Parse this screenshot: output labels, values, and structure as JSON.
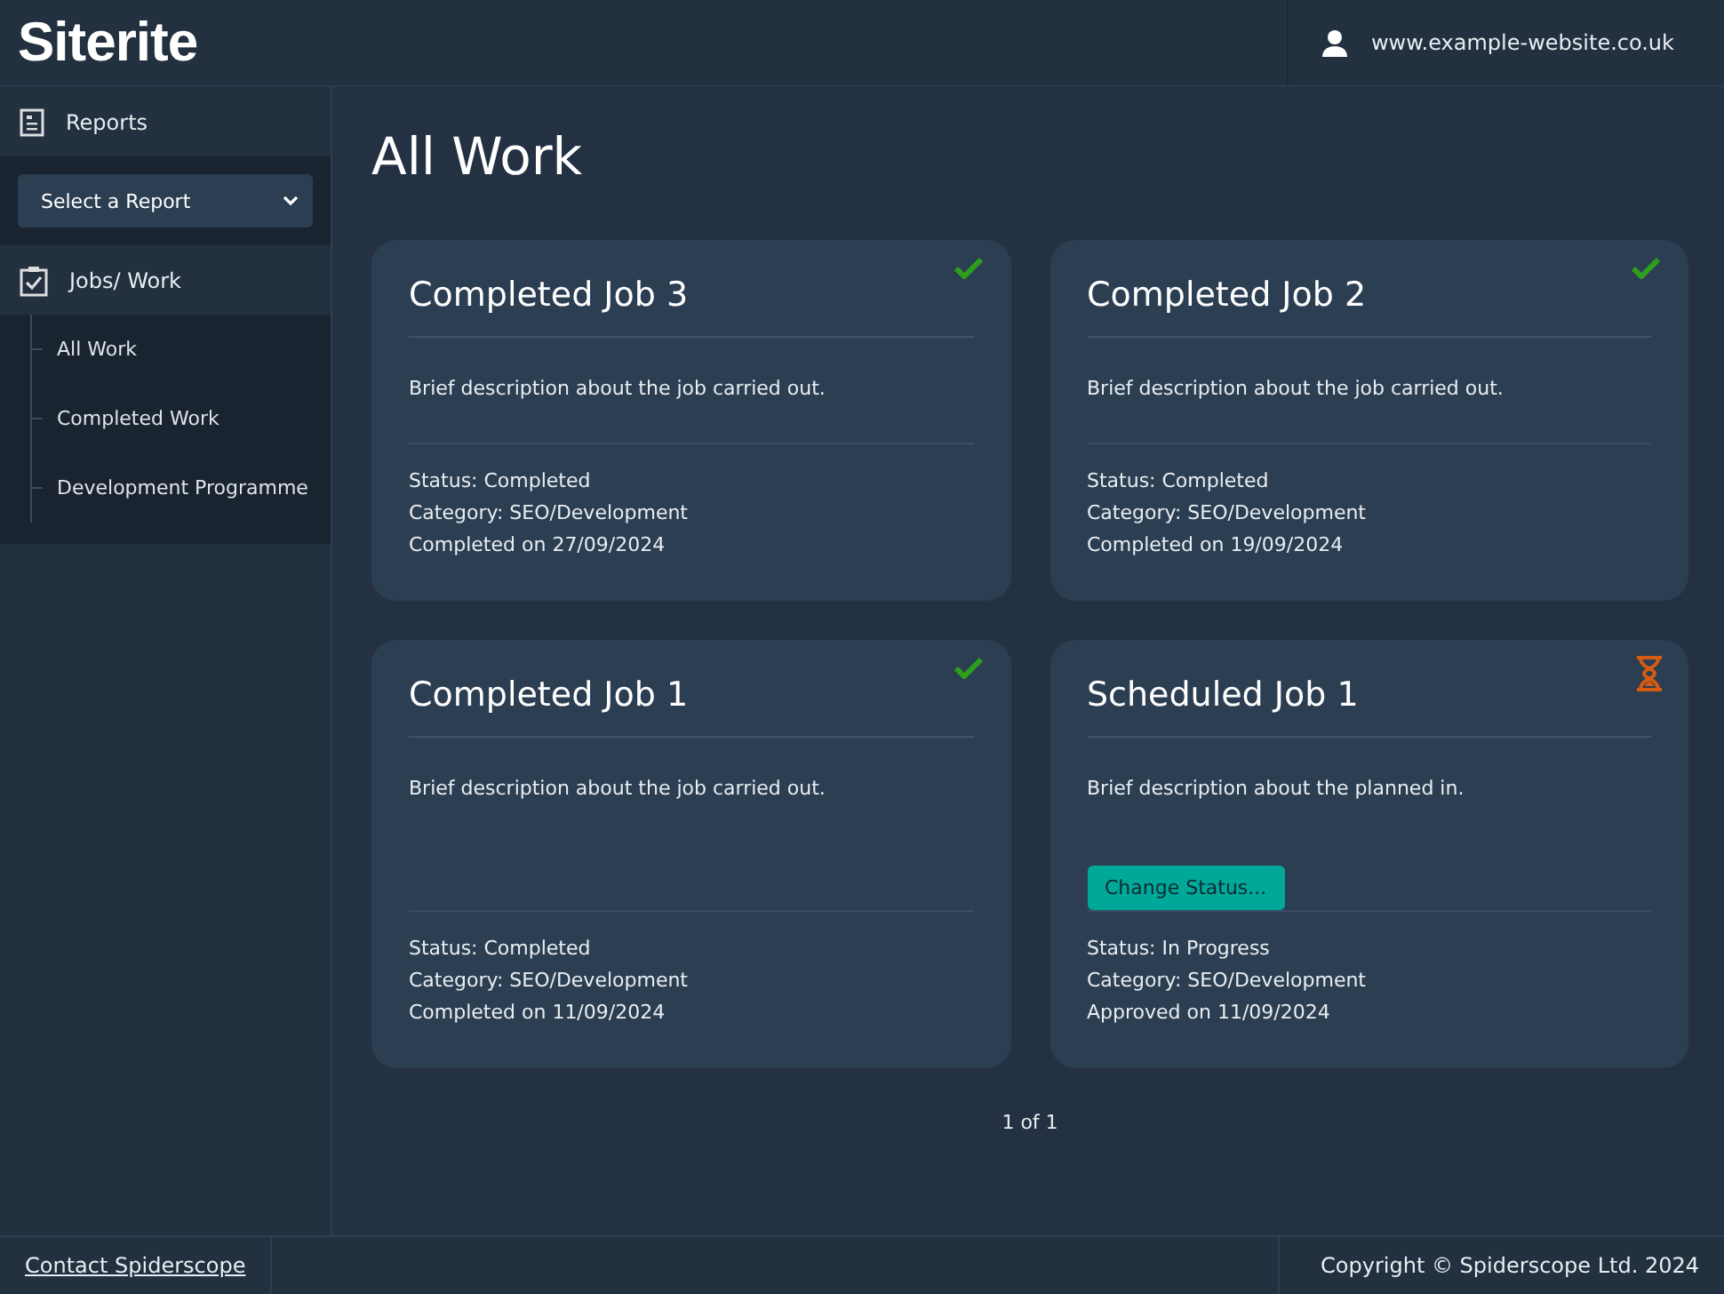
{
  "header": {
    "logo": "Siterite",
    "account": "www.example-website.co.uk"
  },
  "sidebar": {
    "reports_label": "Reports",
    "report_select": {
      "value": "Select a Report"
    },
    "jobs_label": "Jobs/ Work",
    "items": [
      {
        "label": "All Work"
      },
      {
        "label": "Completed Work"
      },
      {
        "label": "Development Programme"
      }
    ]
  },
  "page_title": "All Work",
  "cards": [
    {
      "kind": "completed",
      "title": "Completed Job 3",
      "description": "Brief description about the job carried out.",
      "details": [
        "Status: Completed",
        "Category: SEO/Development",
        "Completed on 27/09/2024"
      ]
    },
    {
      "kind": "completed",
      "title": "Completed Job 2",
      "description": "Brief description about the job carried out.",
      "details": [
        "Status: Completed",
        "Category: SEO/Development",
        "Completed on 19/09/2024"
      ]
    },
    {
      "kind": "completed",
      "title": "Completed Job 1",
      "description": "Brief description about the job carried out.",
      "details": [
        "Status: Completed",
        "Category: SEO/Development",
        "Completed on 11/09/2024"
      ]
    },
    {
      "kind": "scheduled",
      "title": "Scheduled Job 1",
      "description": "Brief description about the planned in.",
      "button": "Change Status...",
      "details": [
        "Status: In Progress",
        "Category: SEO/Development",
        "Approved on 11/09/2024"
      ]
    }
  ],
  "pagination": "1 of 1",
  "footer": {
    "contact_link": "Contact Spiderscope",
    "copyright": "Copyright © Spiderscope Ltd. 2024"
  }
}
